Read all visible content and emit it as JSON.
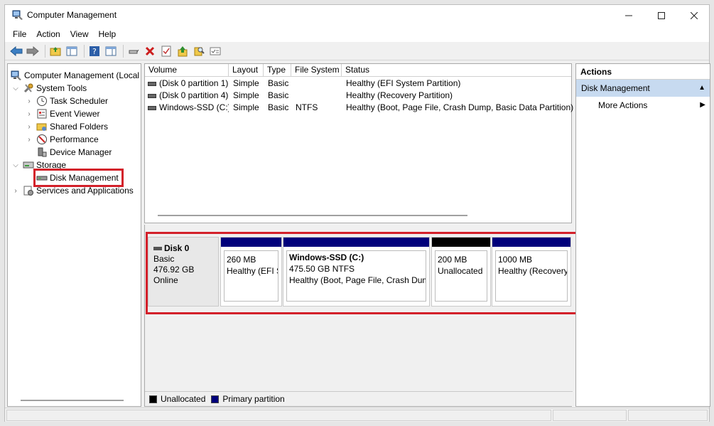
{
  "window": {
    "title": "Computer Management"
  },
  "window_controls": {
    "minimize": "—",
    "maximize": "☐",
    "close": "✕"
  },
  "menu": [
    "File",
    "Action",
    "View",
    "Help"
  ],
  "tree": {
    "root": "Computer Management (Local",
    "items": [
      {
        "label": "System Tools"
      },
      {
        "label": "Task Scheduler"
      },
      {
        "label": "Event Viewer"
      },
      {
        "label": "Shared Folders"
      },
      {
        "label": "Performance"
      },
      {
        "label": "Device Manager"
      },
      {
        "label": "Storage"
      },
      {
        "label": "Disk Management"
      },
      {
        "label": "Services and Applications"
      }
    ]
  },
  "volume_list": {
    "columns": [
      "Volume",
      "Layout",
      "Type",
      "File System",
      "Status"
    ],
    "rows": [
      {
        "volume": "(Disk 0 partition 1)",
        "layout": "Simple",
        "type": "Basic",
        "fs": "",
        "status": "Healthy (EFI System Partition)"
      },
      {
        "volume": "(Disk 0 partition 4)",
        "layout": "Simple",
        "type": "Basic",
        "fs": "",
        "status": "Healthy (Recovery Partition)"
      },
      {
        "volume": "Windows-SSD (C:)",
        "layout": "Simple",
        "type": "Basic",
        "fs": "NTFS",
        "status": "Healthy (Boot, Page File, Crash Dump, Basic Data Partition)"
      }
    ]
  },
  "disk": {
    "name": "Disk 0",
    "kind": "Basic",
    "size": "476.92 GB",
    "state": "Online",
    "partitions": [
      {
        "name": "",
        "size": "260 MB",
        "status": "Healthy (EFI System Partition)",
        "bar_color": "#00007b"
      },
      {
        "name": "Windows-SSD  (C:)",
        "size": "475.50 GB NTFS",
        "status": "Healthy (Boot, Page File, Crash Dump, Basic Data Partition)",
        "bar_color": "#00007b"
      },
      {
        "name": "",
        "size": "200 MB",
        "status": "Unallocated",
        "bar_color": "#000000"
      },
      {
        "name": "",
        "size": "1000 MB",
        "status": "Healthy (Recovery Partition)",
        "bar_color": "#00007b"
      }
    ]
  },
  "legend": {
    "unallocated": {
      "label": "Unallocated",
      "color": "#000000"
    },
    "primary": {
      "label": "Primary partition",
      "color": "#00007b"
    }
  },
  "actions": {
    "header": "Actions",
    "section": "Disk Management",
    "more": "More Actions"
  },
  "colors": {
    "highlight": "#d3202a",
    "selection": "#c7daf0"
  }
}
